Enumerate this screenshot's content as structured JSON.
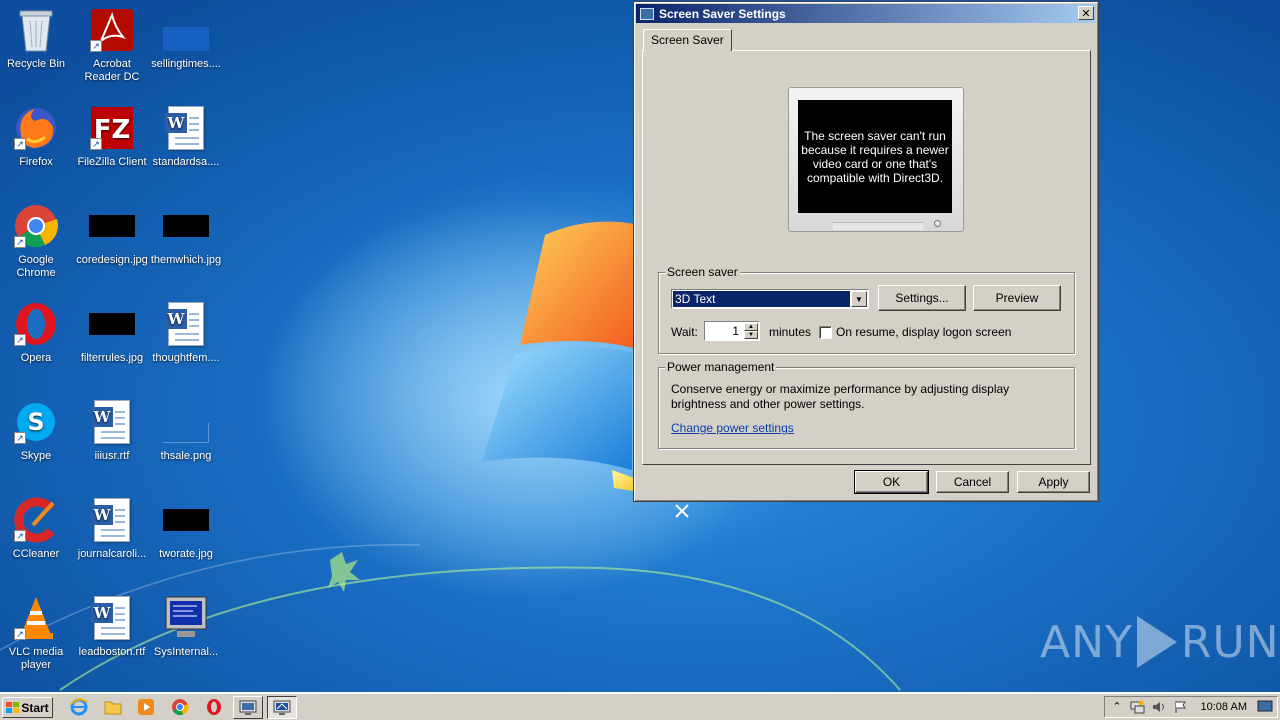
{
  "desktop": {
    "icons": [
      {
        "label": "Recycle Bin",
        "kind": "recycle-bin"
      },
      {
        "label": "Acrobat Reader DC",
        "kind": "acrobat"
      },
      {
        "label": "sellingtimes....",
        "kind": "blank"
      },
      {
        "label": "Firefox",
        "kind": "firefox"
      },
      {
        "label": "FileZilla Client",
        "kind": "filezilla"
      },
      {
        "label": "standardsa....",
        "kind": "word-doc"
      },
      {
        "label": "Google Chrome",
        "kind": "chrome"
      },
      {
        "label": "coredesign.jpg",
        "kind": "black-image"
      },
      {
        "label": "themwhich.jpg",
        "kind": "black-image"
      },
      {
        "label": "Opera",
        "kind": "opera"
      },
      {
        "label": "filterrules.jpg",
        "kind": "black-image"
      },
      {
        "label": "thoughtfem....",
        "kind": "word-doc"
      },
      {
        "label": "Skype",
        "kind": "skype"
      },
      {
        "label": "iiiusr.rtf",
        "kind": "word-doc"
      },
      {
        "label": "thsale.png",
        "kind": "blank"
      },
      {
        "label": "CCleaner",
        "kind": "ccleaner"
      },
      {
        "label": "journalcaroli...",
        "kind": "word-doc"
      },
      {
        "label": "tworate.jpg",
        "kind": "black-image"
      },
      {
        "label": "VLC media player",
        "kind": "vlc"
      },
      {
        "label": "leadboston.rtf",
        "kind": "word-doc"
      },
      {
        "label": "SysInternal...",
        "kind": "sysinternals"
      }
    ],
    "watermark": {
      "left": "ANY",
      "right": "RUN"
    }
  },
  "dialog": {
    "title": "Screen Saver Settings",
    "close_label": "✕",
    "tab_label": "Screen Saver",
    "preview_message": "The screen saver can't run because it requires a newer video card or one that's compatible with Direct3D.",
    "screen_saver_group": {
      "legend": "Screen saver",
      "selected": "3D Text",
      "settings_button": "Settings...",
      "preview_button": "Preview",
      "wait_label": "Wait:",
      "wait_value": "1",
      "minutes_label": "minutes",
      "resume_checkbox_label": "On resume, display logon screen",
      "resume_checked": false
    },
    "power_group": {
      "legend": "Power management",
      "description": "Conserve energy or maximize performance by adjusting display brightness and other power settings.",
      "link": "Change power settings"
    },
    "buttons": {
      "ok": "OK",
      "cancel": "Cancel",
      "apply": "Apply"
    }
  },
  "taskbar": {
    "start_label": "Start",
    "quick_launch": [
      "ie-icon",
      "folder-icon",
      "media-player-icon",
      "chrome-icon",
      "opera-icon"
    ],
    "tasks": [
      "display-settings-icon",
      "screen-saver-icon"
    ],
    "tray_icons": [
      "show-hidden-icons",
      "network-icon",
      "volume-icon",
      "flag-icon"
    ],
    "clock": "10:08 AM"
  },
  "colors": {
    "desktop": "#1a6fc4",
    "title_gradient_start": "#0a246a",
    "title_gradient_end": "#a6caf0",
    "dialog_face": "#d4d0c8",
    "selection": "#0a246a",
    "link": "#0b3ea8"
  }
}
